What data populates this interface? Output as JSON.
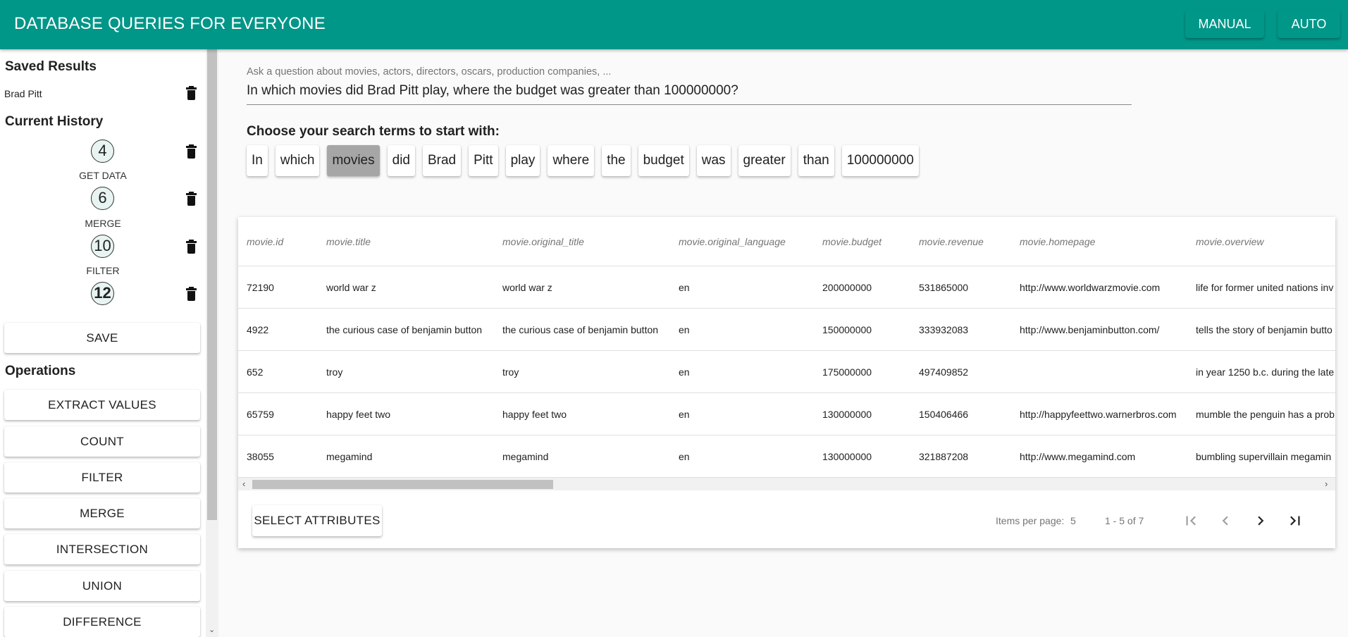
{
  "header": {
    "title": "DATABASE QUERIES FOR EVERYONE",
    "manual_label": "MANUAL",
    "auto_label": "AUTO",
    "color": "#009688"
  },
  "sidebar": {
    "saved_title": "Saved Results",
    "saved_items": [
      "Brad Pitt"
    ],
    "history_title": "Current History",
    "history": [
      {
        "id": "4",
        "label": "GET DATA"
      },
      {
        "id": "6",
        "label": "MERGE"
      },
      {
        "id": "10",
        "label": "FILTER"
      },
      {
        "id": "12",
        "label": ""
      }
    ],
    "save_label": "SAVE",
    "operations_title": "Operations",
    "operations": [
      "EXTRACT VALUES",
      "COUNT",
      "FILTER",
      "MERGE",
      "INTERSECTION",
      "UNION",
      "DIFFERENCE"
    ]
  },
  "query": {
    "placeholder": "Ask a question about movies, actors, directors, oscars, production companies, ...",
    "value": "In which movies did Brad Pitt play, where the budget was greater than 100000000?",
    "choose_title": "Choose your search terms to start with:",
    "terms": [
      "In",
      "which",
      "movies",
      "did",
      "Brad",
      "Pitt",
      "play",
      "where",
      "the",
      "budget",
      "was",
      "greater",
      "than",
      "100000000"
    ],
    "selected_term": "movies"
  },
  "table": {
    "columns": [
      "movie.id",
      "movie.title",
      "movie.original_title",
      "movie.original_language",
      "movie.budget",
      "movie.revenue",
      "movie.homepage",
      "movie.overview"
    ],
    "rows": [
      [
        "72190",
        "world war z",
        "world war z",
        "en",
        "200000000",
        "531865000",
        "http://www.worldwarzmovie.com",
        "life for former united nations inv"
      ],
      [
        "4922",
        "the curious case of benjamin button",
        "the curious case of benjamin button",
        "en",
        "150000000",
        "333932083",
        "http://www.benjaminbutton.com/",
        "tells the story of benjamin butto"
      ],
      [
        "652",
        "troy",
        "troy",
        "en",
        "175000000",
        "497409852",
        "",
        "in year 1250 b.c. during the late"
      ],
      [
        "65759",
        "happy feet two",
        "happy feet two",
        "en",
        "130000000",
        "150406466",
        "http://happyfeettwo.warnerbros.com",
        "mumble the penguin has a prob"
      ],
      [
        "38055",
        "megamind",
        "megamind",
        "en",
        "130000000",
        "321887208",
        "http://www.megamind.com",
        "bumbling supervillain megamin"
      ]
    ],
    "select_attributes_label": "SELECT ATTRIBUTES",
    "items_per_page_label": "Items per page:",
    "items_per_page": "5",
    "range_label": "1 - 5 of 7"
  }
}
